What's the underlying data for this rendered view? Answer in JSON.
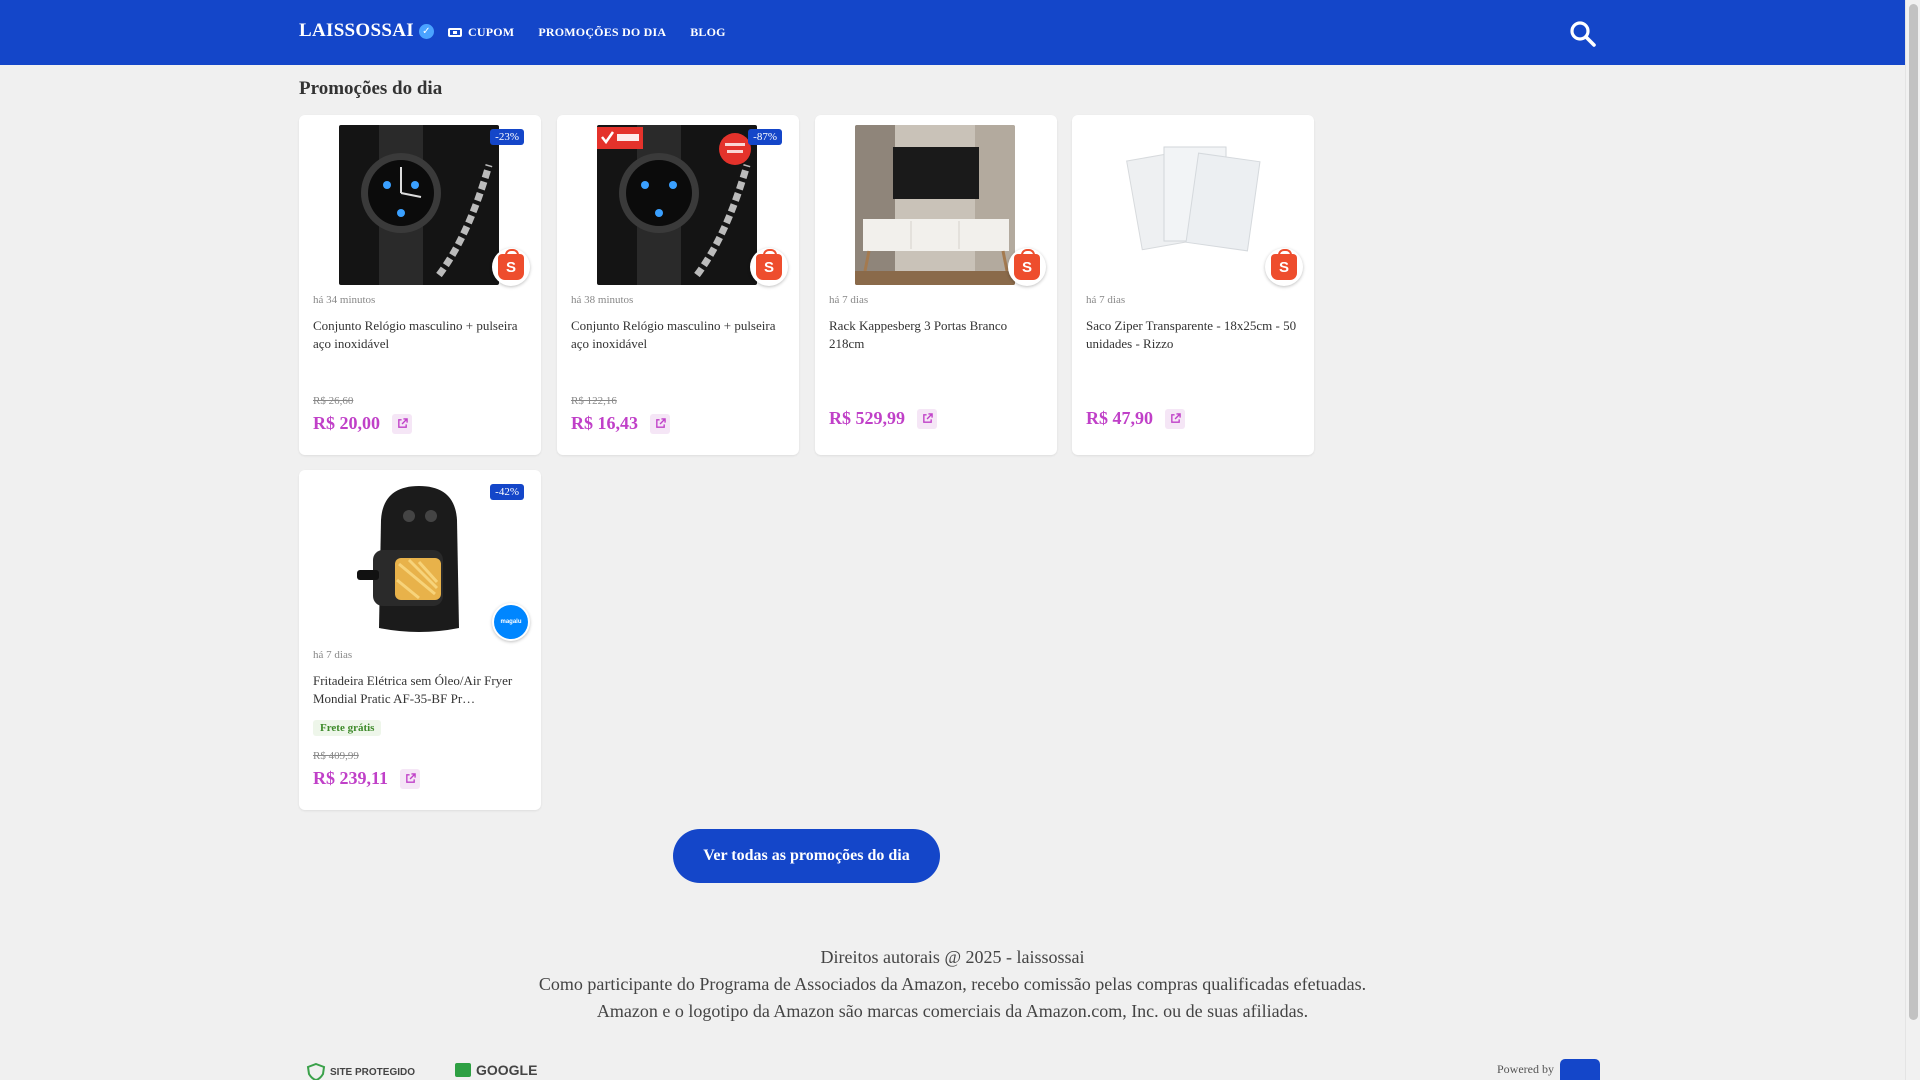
{
  "header": {
    "brand": "LAISSOSSAI",
    "nav": [
      {
        "label": "CUPOM"
      },
      {
        "label": "PROMOÇÕES DO DIA"
      },
      {
        "label": "BLOG"
      }
    ]
  },
  "section_title": "Promoções do dia",
  "products": [
    {
      "discount": "-23%",
      "time": "há 34 minutos",
      "title": "Conjunto Relógio masculino + pulseira aço inoxidável",
      "old_price": "R$ 26,60",
      "price": "R$ 20,00",
      "store": "shopee",
      "store_icon": "S"
    },
    {
      "discount": "-87%",
      "time": "há 38 minutos",
      "title": "Conjunto Relógio masculino + pulseira aço inoxidável",
      "old_price": "R$ 122,16",
      "price": "R$ 16,43",
      "store": "shopee",
      "store_icon": "S"
    },
    {
      "discount": "",
      "time": "há 7 dias",
      "title": "Rack Kappesberg 3 Portas Branco 218cm",
      "old_price": "",
      "price": "R$ 529,99",
      "store": "shopee",
      "store_icon": "S"
    },
    {
      "discount": "",
      "time": "há 7 dias",
      "title": "Saco Ziper Transparente - 18x25cm - 50 unidades - Rizzo",
      "old_price": "",
      "price": "R$ 47,90",
      "store": "shopee",
      "store_icon": "S"
    },
    {
      "discount": "-42%",
      "time": "há 7 dias",
      "title": "Fritadeira Elétrica sem Óleo/Air Fryer Mondial Pratic AF-35-BF Pr…",
      "tag": "Frete grátis",
      "old_price": "R$ 409,99",
      "price": "R$ 239,11",
      "store": "magalu",
      "store_icon": "magalu"
    }
  ],
  "cta_label": "Ver todas as promoções do dia",
  "footer": {
    "line1": "Direitos autorais @ 2025 - laissossai",
    "line2": "Como participante do Programa de Associados da Amazon, recebo comissão pelas compras qualificadas efetuadas.",
    "line3": "Amazon e o logotipo da Amazon são marcas comerciais da Amazon.com, Inc. ou de suas afiliadas.",
    "seal_protected": "SITE PROTEGIDO",
    "seal_google": "GOOGLE",
    "powered_by": "Powered by"
  },
  "colors": {
    "primary": "#1446c9",
    "price": "#c040c8",
    "background": "#f0f0f0",
    "shopee": "#ee4d2d",
    "magalu": "#0086ff"
  }
}
